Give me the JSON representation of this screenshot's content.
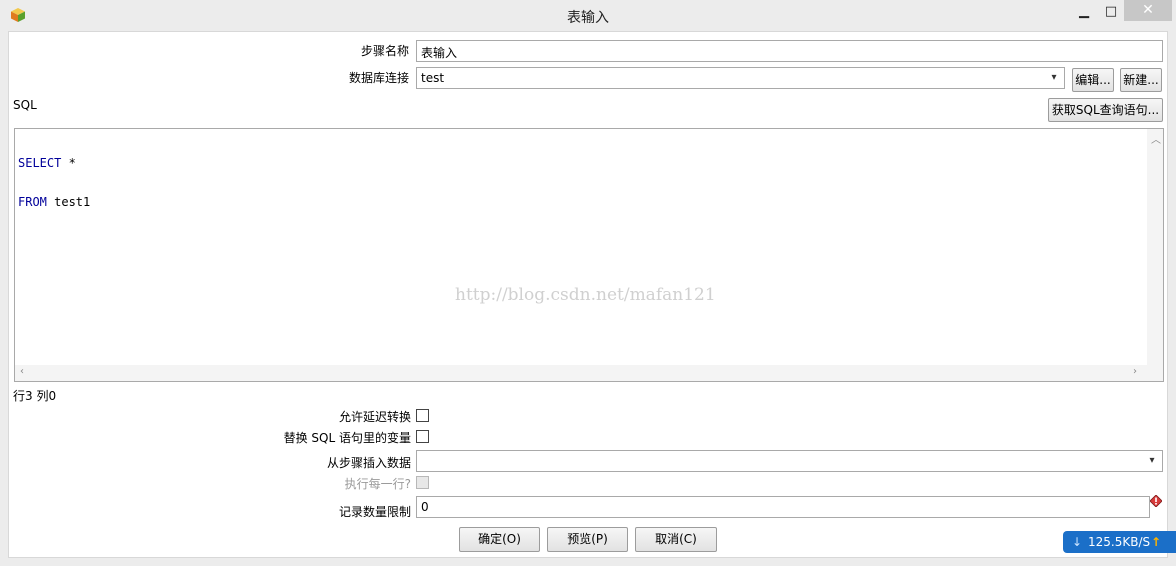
{
  "window": {
    "title": "表输入",
    "minimize_glyph": "▁",
    "maximize_glyph": "□",
    "close_glyph": "✕",
    "app_icon": "kettle-cube-icon"
  },
  "form": {
    "step_name_label": "步骤名称",
    "step_name_value": "表输入",
    "db_conn_label": "数据库连接",
    "db_conn_value": "test",
    "edit_button": "编辑...",
    "new_button": "新建...",
    "sql_label": "SQL",
    "get_sql_button": "获取SQL查询语句...",
    "sql_lines": [
      {
        "keyword": "SELECT",
        "rest": " *"
      },
      {
        "keyword": "FROM",
        "rest": " test1"
      }
    ],
    "watermark": "http://blog.csdn.net/mafan121",
    "cursor_status": "行3 列0",
    "lazy_conversion_label": "允许延迟转换",
    "replace_vars_label": "替换 SQL 语句里的变量",
    "insert_from_step_label": "从步骤插入数据",
    "insert_from_step_value": "",
    "execute_each_row_label": "执行每一行?",
    "limit_label": "记录数量限制",
    "limit_value": "0"
  },
  "buttons": {
    "ok": "确定(O)",
    "preview": "预览(P)",
    "cancel": "取消(C)"
  },
  "network": {
    "speed": "125.5KB/S",
    "down_glyph": "↓",
    "up_glyph": "↑"
  },
  "colors": {
    "sql_keyword": "#00009a",
    "badge_blue": "#1b6fc8",
    "up_arrow": "#ffb400"
  }
}
